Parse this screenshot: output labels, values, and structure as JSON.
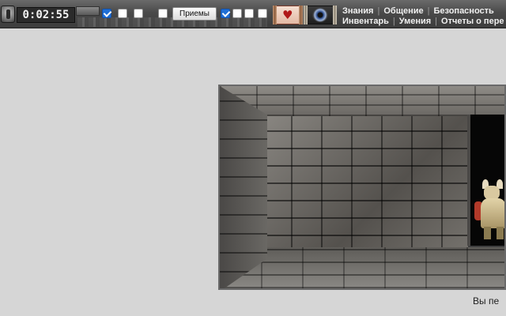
{
  "toolbar": {
    "timer": "0:02:55",
    "checkboxes_group_a": [
      {
        "checked": true
      },
      {
        "checked": false
      },
      {
        "checked": false
      },
      {
        "checked": false
      }
    ],
    "priemy_label": "Приемы",
    "checkboxes_group_b": [
      {
        "checked": true
      },
      {
        "checked": false
      },
      {
        "checked": false
      },
      {
        "checked": false
      }
    ],
    "heart_icon": "heart-scroll-icon",
    "eye_icon": "eye-scroll-icon"
  },
  "menu": {
    "row1": [
      "Знания",
      "Общение",
      "Безопасность"
    ],
    "row2": [
      "Инвентарь",
      "Умения",
      "Отчеты о пере"
    ]
  },
  "status": {
    "text": "Вы пе"
  }
}
